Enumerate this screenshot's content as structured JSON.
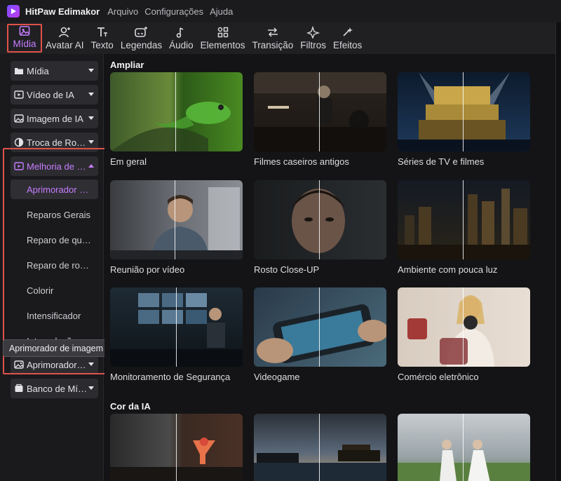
{
  "app": {
    "name": "HitPaw Edimakor",
    "menu": [
      "Arquivo",
      "Configurações",
      "Ajuda"
    ]
  },
  "toolbar": {
    "items": [
      {
        "label": "Mídia",
        "icon": "media-icon"
      },
      {
        "label": "Avatar AI",
        "icon": "avatar-icon"
      },
      {
        "label": "Texto",
        "icon": "text-icon"
      },
      {
        "label": "Legendas",
        "icon": "subtitles-icon"
      },
      {
        "label": "Áudio",
        "icon": "music-note-icon"
      },
      {
        "label": "Elementos",
        "icon": "elements-icon"
      },
      {
        "label": "Transição",
        "icon": "transition-icon"
      },
      {
        "label": "Filtros",
        "icon": "sparkle-icon"
      },
      {
        "label": "Efeitos",
        "icon": "effects-icon"
      }
    ],
    "active": "Mídia"
  },
  "sidebar": {
    "categories": [
      {
        "label": "Mídia",
        "icon": "folder-icon"
      },
      {
        "label": "Vídeo de IA",
        "icon": "video-ai-icon"
      },
      {
        "label": "Imagem de IA",
        "icon": "image-ai-icon"
      },
      {
        "label": "Troca de Rosto",
        "icon": "face-swap-icon"
      },
      {
        "label": "Melhoria de Vídeo",
        "icon": "enhance-video-icon",
        "expanded": true
      }
    ],
    "sub_items": [
      "Aprimorador de vídeo",
      "Reparos Gerais",
      "Reparo de qualidade",
      "Reparo de rosto",
      "Colorir",
      "Intensificador",
      "Interpolação de frames"
    ],
    "selected_sub": "Aprimorador de vídeo",
    "bottom": [
      {
        "label": "Aprimorador de imagem",
        "icon": "image-enhance-icon"
      },
      {
        "label": "Banco de Mídia",
        "icon": "media-bank-icon"
      }
    ],
    "tooltip": "Aprimorador de imagem"
  },
  "content": {
    "sections": [
      {
        "title": "Ampliar",
        "items": [
          "Em geral",
          "Filmes caseiros antigos",
          "Séries de TV e filmes",
          "Reunião por vídeo",
          "Rosto Close-UP",
          "Ambiente com pouca luz",
          "Monitoramento de Segurança",
          "Videogame",
          "Comércio eletrônico"
        ]
      },
      {
        "title": "Cor da IA",
        "items": [
          "",
          "",
          ""
        ]
      }
    ]
  },
  "colors": {
    "accent": "#c77dff",
    "highlight_box": "#e0524a",
    "background": "#141416",
    "panel": "#1a1a1d"
  }
}
